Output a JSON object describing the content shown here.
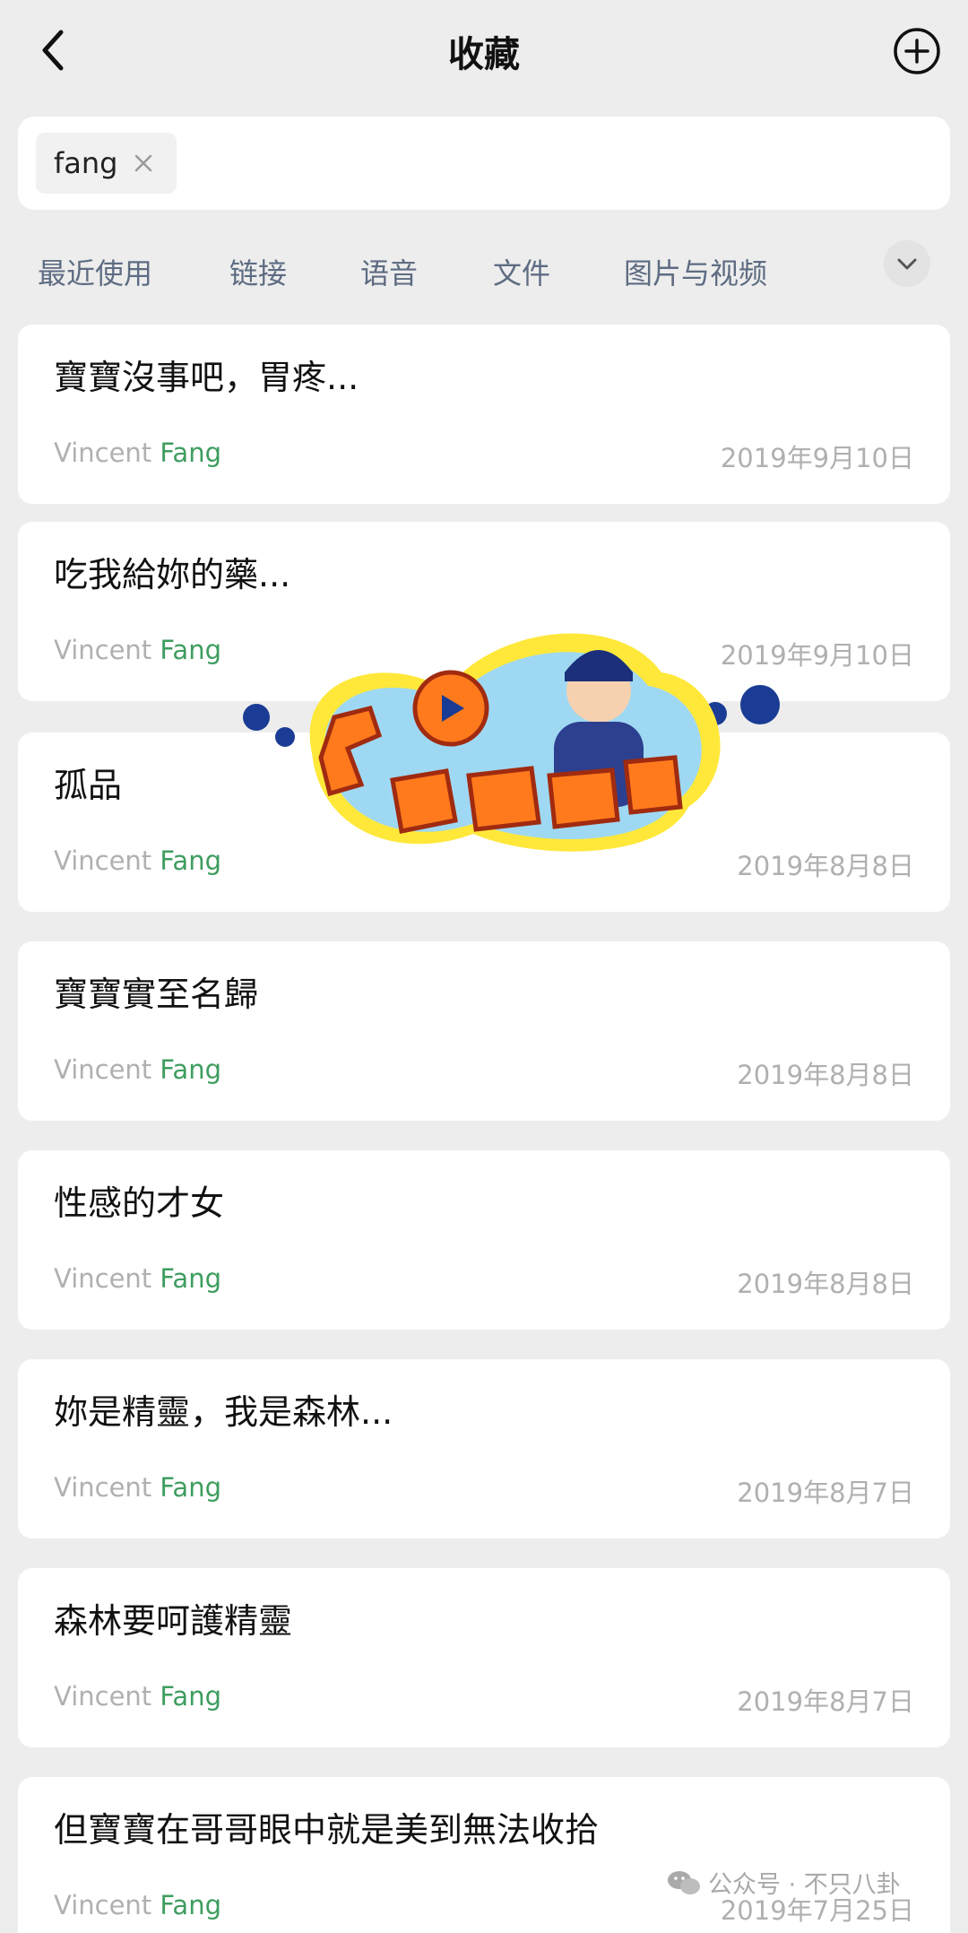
{
  "header": {
    "title": "收藏"
  },
  "search": {
    "tag": "fang"
  },
  "filters": [
    "最近使用",
    "链接",
    "语音",
    "文件",
    "图片与视频"
  ],
  "items": [
    {
      "title": "寶寶沒事吧，胃疼...",
      "author_first": "Vincent ",
      "author_last": "Fang",
      "date": "2019年9月10日"
    },
    {
      "title": "吃我給妳的藥...",
      "author_first": "Vincent ",
      "author_last": "Fang",
      "date": "2019年9月10日"
    },
    {
      "title": "孤品",
      "author_first": "Vincent ",
      "author_last": "Fang",
      "date": "2019年8月8日"
    },
    {
      "title": "寶寶實至名歸",
      "author_first": "Vincent ",
      "author_last": "Fang",
      "date": "2019年8月8日"
    },
    {
      "title": "性感的才女",
      "author_first": "Vincent ",
      "author_last": "Fang",
      "date": "2019年8月8日"
    },
    {
      "title": "妳是精靈，我是森林...",
      "author_first": "Vincent ",
      "author_last": "Fang",
      "date": "2019年8月7日"
    },
    {
      "title": "森林要呵護精靈",
      "author_first": "Vincent ",
      "author_last": "Fang",
      "date": "2019年8月7日"
    },
    {
      "title": "但寶寶在哥哥眼中就是美到無法收拾",
      "author_first": "Vincent ",
      "author_last": "Fang",
      "date": "2019年7月25日"
    }
  ],
  "watermark": {
    "text": "公众号 · 不只八卦"
  },
  "icons": {
    "back": "chevron-left-icon",
    "add": "plus-circle-icon",
    "tag_close": "close-icon",
    "filters_more": "chevron-down-icon"
  },
  "colors": {
    "highlight": "#3e9d5f",
    "filter_text": "#5e6c82",
    "muted": "#b0b0b0"
  }
}
